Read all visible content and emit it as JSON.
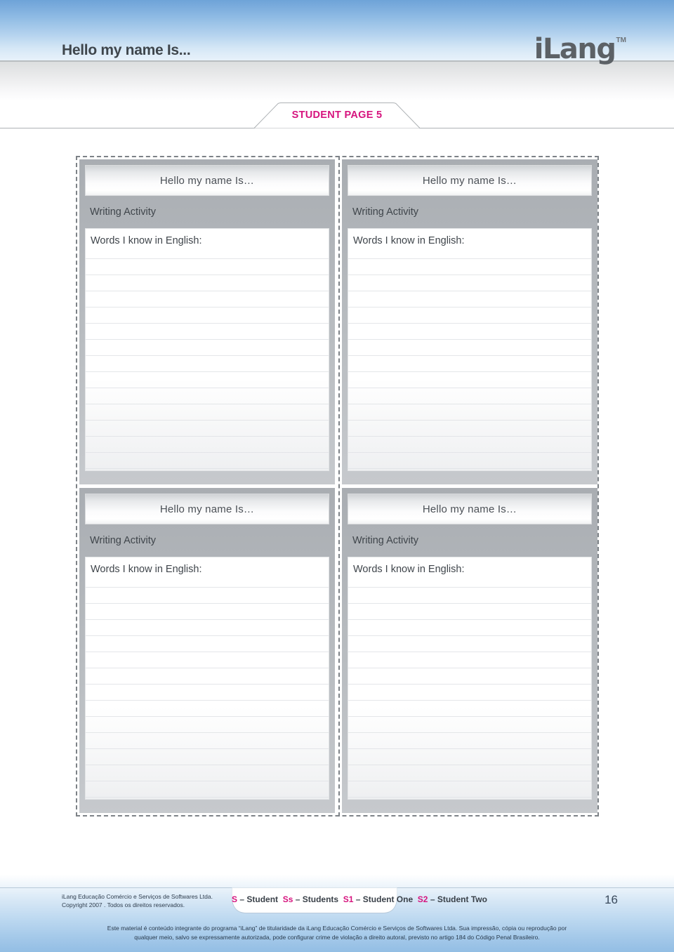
{
  "header": {
    "title": "Hello my name Is...",
    "logo_text": "iLang",
    "logo_tm": "TM",
    "tab_label": "STUDENT PAGE 5"
  },
  "worksheet": {
    "cards": [
      {
        "title": "Hello my name Is…",
        "activity": "Writing Activity",
        "prompt": "Words I know in English:"
      },
      {
        "title": "Hello my name Is…",
        "activity": "Writing Activity",
        "prompt": "Words I know in English:"
      },
      {
        "title": "Hello my name Is…",
        "activity": "Writing Activity",
        "prompt": "Words I know in English:"
      },
      {
        "title": "Hello my name Is…",
        "activity": "Writing Activity",
        "prompt": "Words I know in English:"
      }
    ]
  },
  "footer": {
    "copyright_line1": "iLang Educação Comércio e Serviços de Softwares Ltda.",
    "copyright_line2": "Copyright 2007 . Todos os direitos reservados.",
    "legend": {
      "k1": "S",
      "v1": "– Student",
      "k2": "Ss",
      "v2": "– Students",
      "k3": "S1",
      "v3": "– Student One",
      "k4": "S2",
      "v4": "– Student Two"
    },
    "page_number": "16",
    "legal_line1": "Este material é conteúdo integrante do programa “iLang” de titularidade da iLang Educação Comércio e Serviços de Softwares Ltda. Sua impressão, cópia ou reprodução por",
    "legal_line2": "qualquer meio, salvo se expressamente autorizada, pode configurar crime de violação a direito autoral, previsto no artigo 184 do Código Penal Brasileiro."
  },
  "colors": {
    "accent_magenta": "#d6147e",
    "header_blue": "#6ea3d8",
    "card_gray": "#b9bdc1",
    "text_dark": "#3f454b"
  }
}
